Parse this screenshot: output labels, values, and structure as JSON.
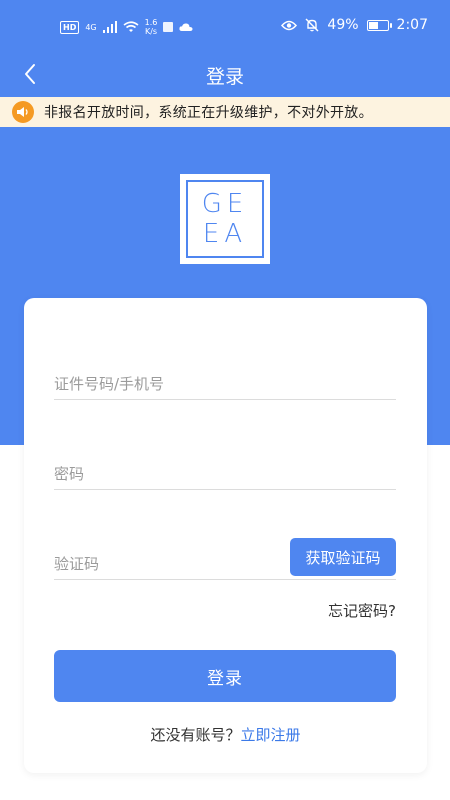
{
  "status_bar": {
    "hd": "HD",
    "network": "4G",
    "speed_value": "1.6",
    "speed_unit": "K/s",
    "battery": "49%",
    "time": "2:07"
  },
  "nav": {
    "title": "登录"
  },
  "notice": {
    "text": "非报名开放时间，系统正在升级维护，不对外开放。"
  },
  "logo": {
    "line1": "GE",
    "line2": "EA"
  },
  "form": {
    "id_placeholder": "证件号码/手机号",
    "password_placeholder": "密码",
    "code_placeholder": "验证码",
    "get_code_label": "获取验证码",
    "forgot_label": "忘记密码?",
    "login_label": "登录",
    "register_prompt": "还没有账号？",
    "register_link": "立即注册"
  },
  "colors": {
    "primary": "#4f86f0",
    "notice_bg": "#fdf3e0",
    "notice_icon": "#f59a23"
  }
}
